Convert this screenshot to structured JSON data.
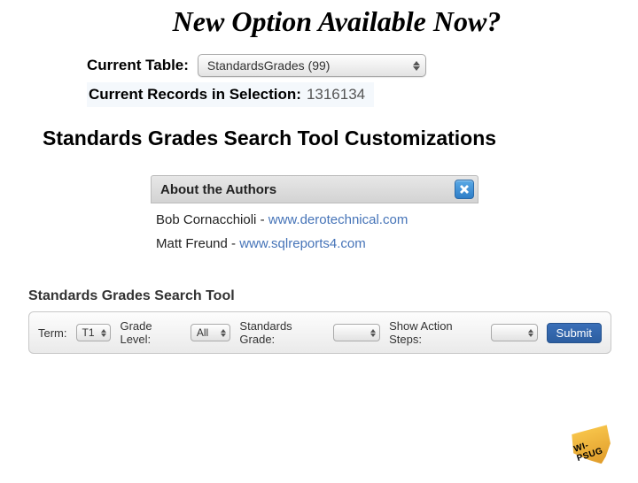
{
  "title": "New Option Available Now?",
  "current": {
    "table_label": "Current Table:",
    "table_value": "StandardsGrades (99)",
    "records_label": "Current Records in Selection:",
    "records_value": "1316134"
  },
  "subtitle": "Standards Grades Search Tool Customizations",
  "authors": {
    "header": "About the Authors",
    "rows": [
      {
        "name": "Bob Cornacchioli",
        "sep": " - ",
        "link": "www.derotechnical.com"
      },
      {
        "name": "Matt Freund",
        "sep": " - ",
        "link": "www.sqlreports4.com"
      }
    ]
  },
  "tool": {
    "title": "Standards Grades Search Tool",
    "term_label": "Term:",
    "term_value": "T1",
    "grade_label": "Grade Level:",
    "grade_value": "All",
    "std_label": "Standards Grade:",
    "std_value": "",
    "steps_label": "Show Action Steps:",
    "steps_value": "",
    "submit": "Submit"
  },
  "logo_text": "WI-PSUG"
}
